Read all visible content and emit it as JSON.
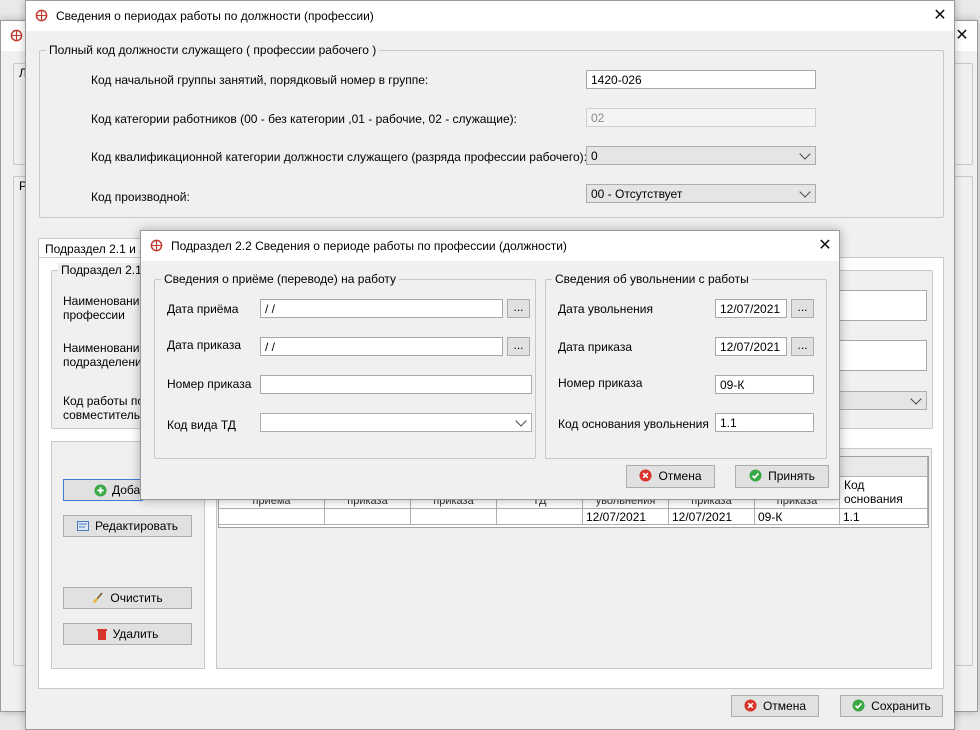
{
  "main_dialog": {
    "title": "Сведения о периодах работы по должности (профессии)",
    "code_group": {
      "legend": "Полный код должности служащего ( профессии рабочего )",
      "row1_label": "Код начальной группы занятий, порядковый номер в группе:",
      "row1_value": "1420-026",
      "row2_label": "Код категории работников (00 - без категории ,01 - рабочие, 02 - служащие):",
      "row2_value": "02",
      "row3_label": "Код квалификационной категории должности служащего (разряда профессии рабочего):",
      "row3_value": "0",
      "row4_label": "Код производной:",
      "row4_value": "00 - Отсутствует"
    },
    "tab_label": "Подраздел 2.1 и 2.",
    "subgroup_legend": "Подраздел 2.1",
    "left_labels": {
      "name_profession_1": "Наименование д",
      "name_profession_2": "профессии",
      "name_subdivision_1": "Наименование",
      "name_subdivision_2": "подразделения",
      "work_code_1": "Код работы по",
      "work_code_2": "совместительст"
    },
    "buttons": {
      "add": "Добав",
      "edit": "Редактировать",
      "clear": "Очистить",
      "delete": "Удалить",
      "cancel": "Отмена",
      "save": "Сохранить"
    },
    "table": {
      "header_partial": [
        "приема",
        "приказа",
        "приказа",
        "ТД",
        "увольнения",
        "приказа",
        "приказа"
      ],
      "last_header": "Код основания увольнения",
      "row": [
        "",
        "",
        "",
        "",
        "12/07/2021",
        "12/07/2021",
        "09-К",
        "1.1"
      ]
    }
  },
  "background_window": {
    "letter_1": "Л",
    "letter_2": "Р"
  },
  "sub_dialog": {
    "title": "Подраздел 2.2 Сведения о периоде работы по профессии (должности)",
    "hire_group": {
      "legend": "Сведения о приёме (переводе) на работу",
      "hire_date_label": "Дата приёма",
      "hire_date_value": " / /",
      "order_date_label": "Дата приказа",
      "order_date_value": " / /",
      "order_number_label": "Номер приказа",
      "order_number_value": "",
      "td_code_label": "Код вида ТД",
      "td_code_value": ""
    },
    "dismiss_group": {
      "legend": "Сведения об увольнении с работы",
      "dismiss_date_label": "Дата увольнения",
      "dismiss_date_value": "12/07/2021",
      "order_date_label": "Дата приказа",
      "order_date_value": "12/07/2021",
      "order_number_label": "Номер приказа",
      "order_number_value": "09-К",
      "reason_code_label": "Код основания увольнения",
      "reason_code_value": "1.1"
    },
    "dots_label": "...",
    "cancel_label": "Отмена",
    "accept_label": "Принять"
  },
  "colors": {
    "cancel_icon": "#d9342b",
    "ok_icon": "#3aa845",
    "add_icon": "#3aa845",
    "delete_icon": "#d9342b",
    "app_icon": "#c0392b"
  }
}
